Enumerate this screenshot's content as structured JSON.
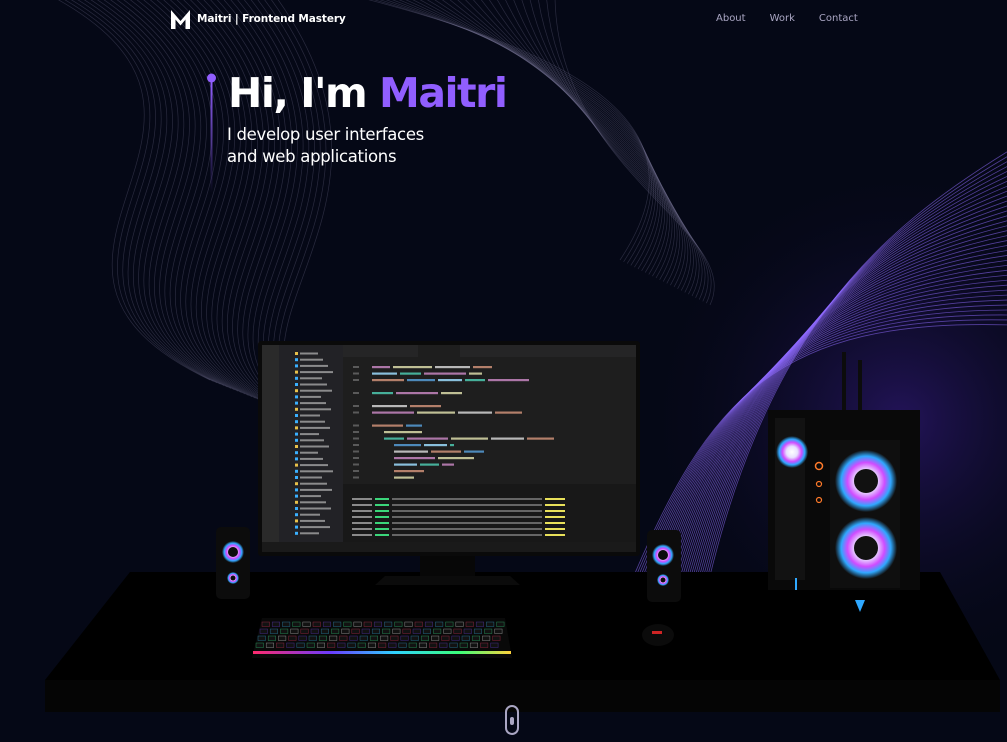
{
  "nav": {
    "brand_name": "Maitri | Frontend Mastery",
    "links": [
      "About",
      "Work",
      "Contact"
    ]
  },
  "hero": {
    "greeting": "Hi, I'm ",
    "name": "Maitri",
    "subtitle_line1": "I develop user interfaces",
    "subtitle_line2": "and web applications"
  },
  "colors": {
    "background": "#050816",
    "accent": "#915eff",
    "nav_text": "#aaa6c3",
    "wave_lines": "#7d5bd6"
  },
  "icons": [
    "logo-m-icon",
    "scroll-mouse-icon"
  ]
}
